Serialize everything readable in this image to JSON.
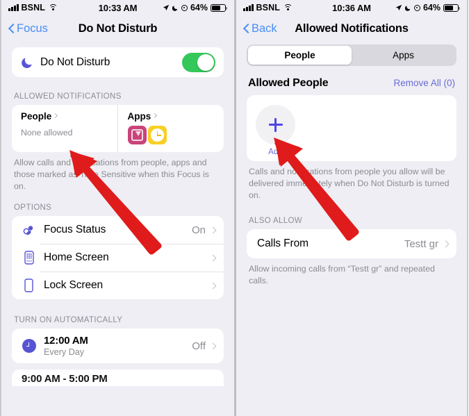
{
  "left": {
    "status": {
      "carrier": "BSNL",
      "time": "10:33 AM",
      "battery_pct": "64%",
      "icons": [
        "signal-bars-icon",
        "wifi-icon",
        "location-arrow-icon",
        "crescent-moon-icon",
        "target-icon",
        "battery-icon"
      ]
    },
    "nav": {
      "back_label": "Focus",
      "title": "Do Not Disturb"
    },
    "dnd": {
      "label": "Do Not Disturb",
      "toggle_state": "on",
      "toggle_color": "#34c759",
      "moon_color": "#5856d6"
    },
    "allowed_section": {
      "header": "ALLOWED NOTIFICATIONS",
      "people": {
        "title": "People",
        "subtitle": "None allowed"
      },
      "apps": {
        "title": "Apps",
        "icons": [
          "files-app-icon",
          "clock-app-icon"
        ]
      },
      "footnote": "Allow calls and notifications from people, apps and those marked as Time Sensitive when this Focus is on."
    },
    "options_section": {
      "header": "OPTIONS",
      "rows": [
        {
          "label": "Focus Status",
          "value": "On",
          "icon": "focus-status-icon"
        },
        {
          "label": "Home Screen",
          "value": "",
          "icon": "home-screen-icon"
        },
        {
          "label": "Lock Screen",
          "value": "",
          "icon": "lock-screen-icon"
        }
      ]
    },
    "schedule_section": {
      "header": "TURN ON AUTOMATICALLY",
      "rows": [
        {
          "time": "12:00 AM",
          "repeat": "Every Day",
          "value": "Off",
          "icon": "clock-icon"
        }
      ],
      "peek_row": {
        "time": "9:00 AM - 5:00 PM"
      }
    }
  },
  "right": {
    "status": {
      "carrier": "BSNL",
      "time": "10:36 AM",
      "battery_pct": "64%"
    },
    "nav": {
      "back_label": "Back",
      "title": "Allowed Notifications"
    },
    "segmented": {
      "options": [
        "People",
        "Apps"
      ],
      "selected": "People"
    },
    "allowed_people": {
      "title": "Allowed People",
      "action": "Remove All (0)",
      "action_color": "#6b6bd8",
      "add_label": "Add",
      "footnote": "Calls and notifications from people you allow will be delivered immediately when Do Not Disturb is turned on."
    },
    "also_allow": {
      "header": "ALSO ALLOW",
      "row": {
        "label": "Calls From",
        "value": "Testt gr"
      },
      "footnote": "Allow incoming calls from “Testt gr” and repeated calls."
    }
  },
  "annotations": {
    "arrow_color": "#e01b1b",
    "arrows": [
      {
        "name": "arrow-pointing-to-none-allowed",
        "panel": "left"
      },
      {
        "name": "arrow-pointing-to-add-button",
        "panel": "right"
      }
    ]
  }
}
